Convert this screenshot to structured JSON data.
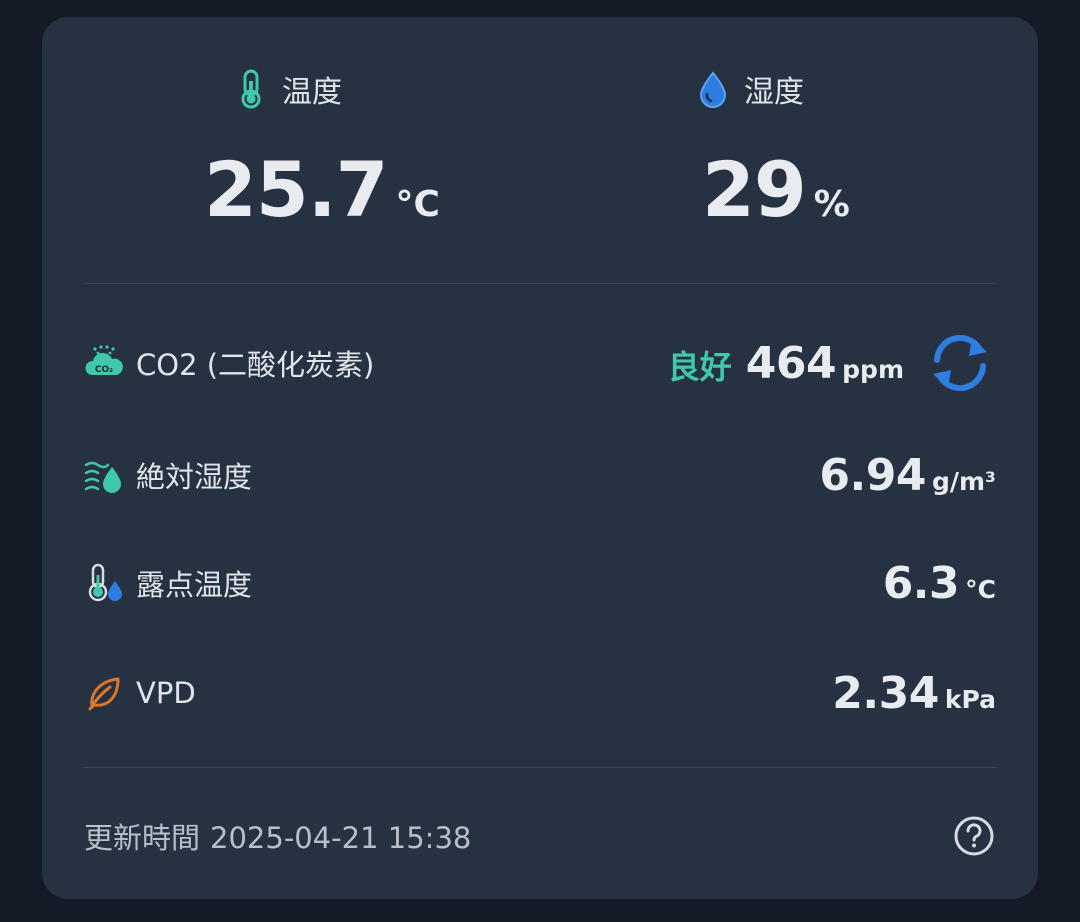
{
  "temperature": {
    "label": "温度",
    "value": "25.7",
    "unit": "°C",
    "icon": "thermometer-icon"
  },
  "humidity": {
    "label": "湿度",
    "value": "29",
    "unit": "%",
    "icon": "water-drop-icon"
  },
  "co2": {
    "label": "CO2 (二酸化炭素)",
    "status": "良好",
    "value": "464",
    "unit": "ppm",
    "icon": "co2-cloud-icon",
    "action_icon": "refresh-icon"
  },
  "absolute_humidity": {
    "label": "絶対湿度",
    "value": "6.94",
    "unit": "g/m³",
    "icon": "wind-drop-icon"
  },
  "dew_point": {
    "label": "露点温度",
    "value": "6.3",
    "unit": "°C",
    "icon": "thermometer-drop-icon"
  },
  "vpd": {
    "label": "VPD",
    "value": "2.34",
    "unit": "kPa",
    "icon": "leaf-icon"
  },
  "footer": {
    "updated_label": "更新時間",
    "updated_time": "2025-04-21 15:38",
    "help_icon": "help-icon"
  },
  "colors": {
    "background": "#141a26",
    "card": "#263142",
    "accent_green": "#3fc9a8",
    "accent_blue": "#2f7de1",
    "leaf_orange": "#d9772b",
    "text": "#e8ebf0"
  }
}
